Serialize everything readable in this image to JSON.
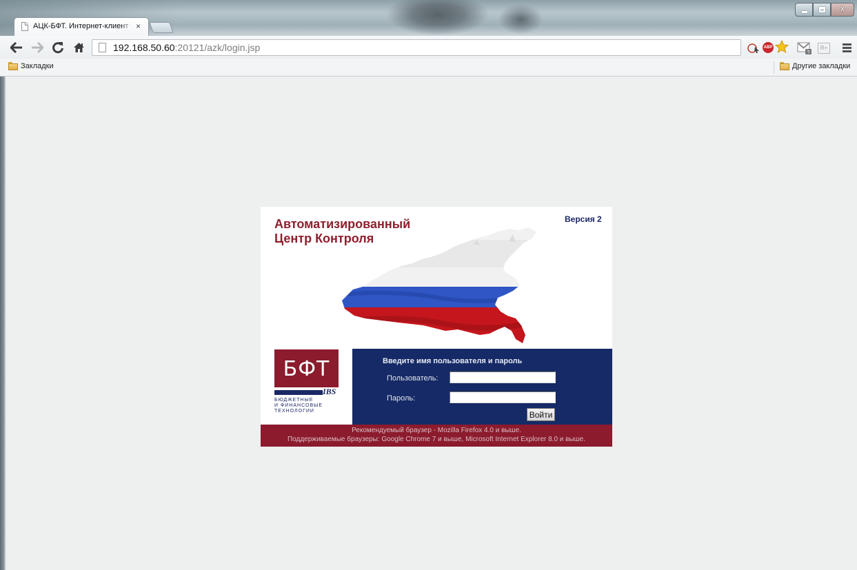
{
  "browser": {
    "tab": {
      "title": "АЦК-БФТ. Интернет-клиент",
      "close": "×"
    },
    "window_controls": {
      "close": "x"
    },
    "url": {
      "host": "192.168.50.60",
      "rest": ":20121/azk/login.jsp"
    },
    "bookmarks": {
      "left": "Закладки",
      "right": "Другие закладки"
    },
    "extensions": [
      "cast-icon",
      "adblock-icon",
      "star-icon",
      "gmail-checker-icon",
      "extension-icon"
    ],
    "extension_labels": {
      "adblock": "ABP",
      "ext": "R+"
    }
  },
  "page": {
    "title_line1": "Автоматизированный",
    "title_line2": "Центр Контроля",
    "version": "Версия 2",
    "logo": {
      "mark": "БФТ",
      "ibs": "IBS",
      "line1": "БЮДЖЕТНЫЕ",
      "line2": "И ФИНАНСОВЫЕ",
      "line3": "ТЕХНОЛОГИИ"
    },
    "form": {
      "heading": "Введите имя пользователя и пароль",
      "user_label": "Пользователь:",
      "user_value": "",
      "pass_label": "Пароль:",
      "pass_value": "",
      "submit": "Войти"
    },
    "footer": {
      "line1": "Рекомендуемый браузер - Mozilla Firefox 4.0 и выше.",
      "line2": "Поддерживаемые браузеры: Google Chrome 7 и выше, Microsoft Internet Explorer 8.0 и выше."
    }
  },
  "colors": {
    "brand_red": "#8b1b2d",
    "brand_blue": "#152a66",
    "page_bg": "#eeefef"
  }
}
